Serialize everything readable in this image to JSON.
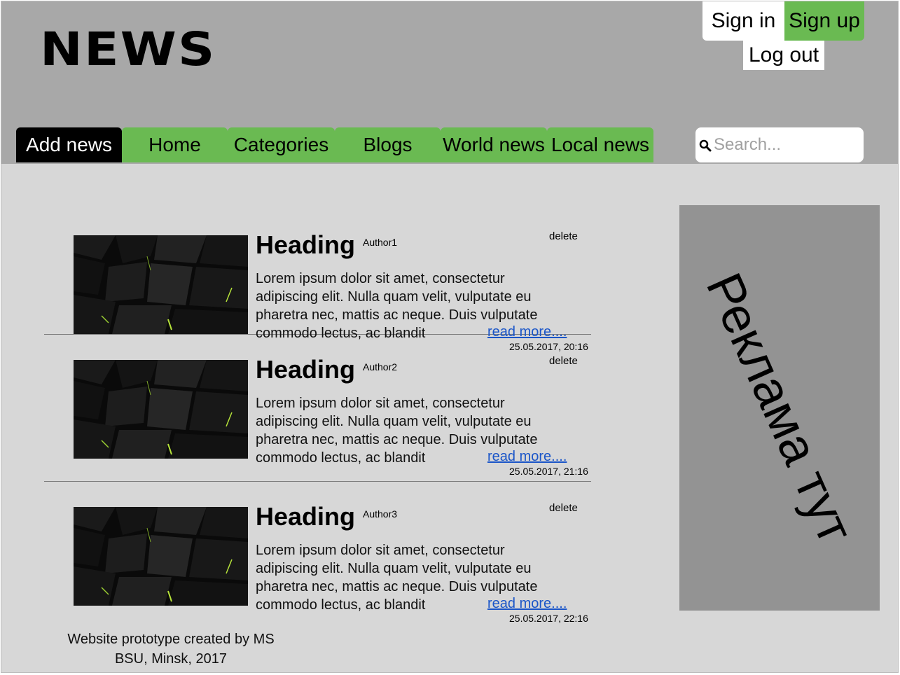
{
  "header": {
    "logo": "NEWS",
    "auth": {
      "sign_in": "Sign in",
      "sign_up": "Sign up",
      "log_out": "Log out"
    }
  },
  "nav": {
    "tabs": [
      {
        "label": "Add news",
        "active": true
      },
      {
        "label": "Home"
      },
      {
        "label": "Categories"
      },
      {
        "label": "Blogs"
      },
      {
        "label": "World news"
      },
      {
        "label": "Local news"
      }
    ]
  },
  "search": {
    "placeholder": "Search...",
    "value": ""
  },
  "articles": [
    {
      "heading": "Heading",
      "author": "Author1",
      "delete_label": "delete",
      "text": "Lorem ipsum dolor sit amet, consectetur adipiscing elit. Nulla quam velit, vulputate eu pharetra nec, mattis ac neque. Duis vulputate commodo lectus, ac blandit",
      "read_more": "read more....",
      "date": "25.05.2017, 20:16"
    },
    {
      "heading": "Heading",
      "author": "Author2",
      "delete_label": "delete",
      "text": "Lorem ipsum dolor sit amet, consectetur adipiscing elit. Nulla quam velit, vulputate eu pharetra nec, mattis ac neque. Duis vulputate commodo lectus, ac blandit",
      "read_more": "read more....",
      "date": "25.05.2017, 21:16"
    },
    {
      "heading": "Heading",
      "author": "Author3",
      "delete_label": "delete",
      "text": "Lorem ipsum dolor sit amet, consectetur adipiscing elit. Nulla quam velit, vulputate eu pharetra nec, mattis ac neque. Duis vulputate commodo lectus, ac blandit",
      "read_more": "read more....",
      "date": "25.05.2017, 22:16"
    }
  ],
  "ad": {
    "text": "Реклама тут"
  },
  "footer": {
    "line1": "Website prototype created by MS",
    "line2": "BSU, Minsk, 2017"
  },
  "colors": {
    "header_bg": "#a8a8a8",
    "content_bg": "#d7d7d7",
    "accent_green": "#6aba52",
    "active_tab": "#000000",
    "ad_bg": "#939393",
    "link": "#1a55c8"
  },
  "icons": {
    "search": "search-icon"
  }
}
